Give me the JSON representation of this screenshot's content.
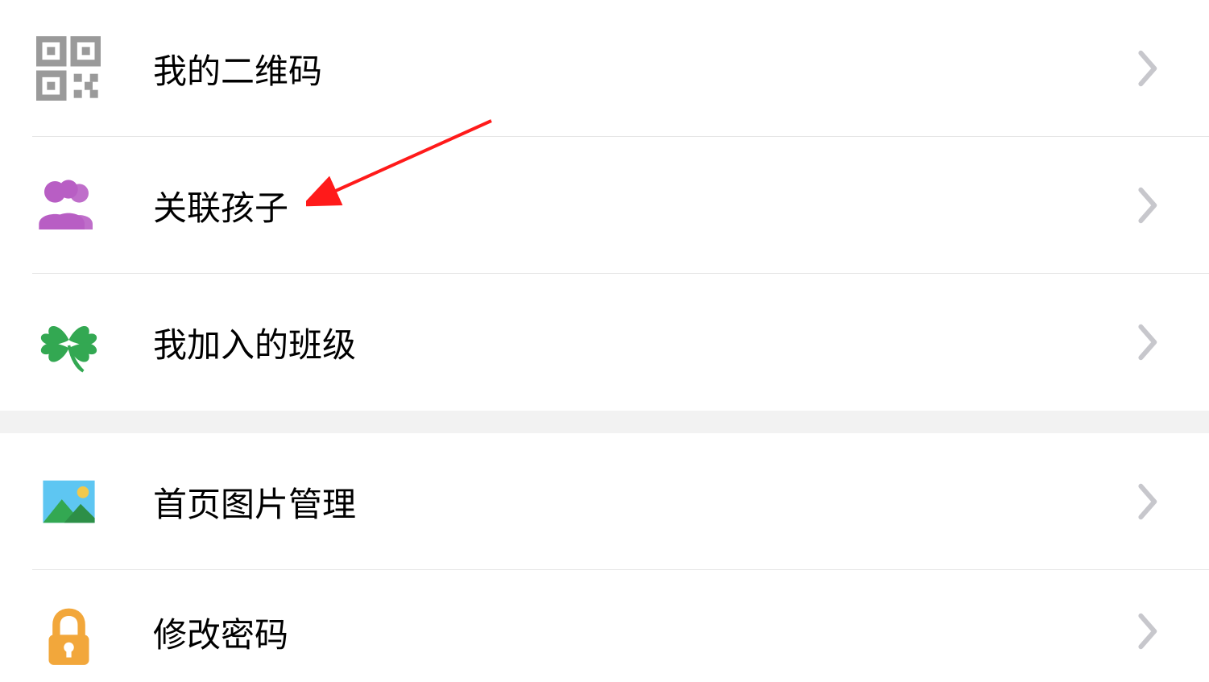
{
  "menu": {
    "items": [
      {
        "icon": "qrcode-icon",
        "label": "我的二维码"
      },
      {
        "icon": "people-icon",
        "label": "关联孩子"
      },
      {
        "icon": "clover-icon",
        "label": "我加入的班级"
      },
      {
        "icon": "picture-icon",
        "label": "首页图片管理"
      },
      {
        "icon": "lock-icon",
        "label": "修改密码"
      }
    ]
  },
  "annotation": {
    "type": "arrow",
    "target": "关联孩子",
    "color": "#ff1a1a"
  }
}
